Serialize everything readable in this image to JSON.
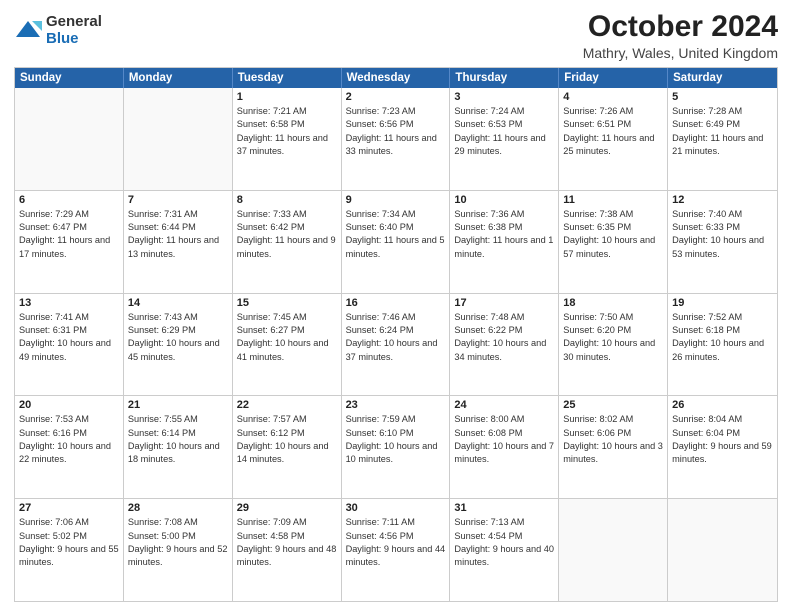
{
  "logo": {
    "general": "General",
    "blue": "Blue"
  },
  "title": "October 2024",
  "location": "Mathry, Wales, United Kingdom",
  "header": {
    "days": [
      "Sunday",
      "Monday",
      "Tuesday",
      "Wednesday",
      "Thursday",
      "Friday",
      "Saturday"
    ]
  },
  "weeks": [
    [
      {
        "day": "",
        "sunrise": "",
        "sunset": "",
        "daylight": ""
      },
      {
        "day": "",
        "sunrise": "",
        "sunset": "",
        "daylight": ""
      },
      {
        "day": "1",
        "sunrise": "Sunrise: 7:21 AM",
        "sunset": "Sunset: 6:58 PM",
        "daylight": "Daylight: 11 hours and 37 minutes."
      },
      {
        "day": "2",
        "sunrise": "Sunrise: 7:23 AM",
        "sunset": "Sunset: 6:56 PM",
        "daylight": "Daylight: 11 hours and 33 minutes."
      },
      {
        "day": "3",
        "sunrise": "Sunrise: 7:24 AM",
        "sunset": "Sunset: 6:53 PM",
        "daylight": "Daylight: 11 hours and 29 minutes."
      },
      {
        "day": "4",
        "sunrise": "Sunrise: 7:26 AM",
        "sunset": "Sunset: 6:51 PM",
        "daylight": "Daylight: 11 hours and 25 minutes."
      },
      {
        "day": "5",
        "sunrise": "Sunrise: 7:28 AM",
        "sunset": "Sunset: 6:49 PM",
        "daylight": "Daylight: 11 hours and 21 minutes."
      }
    ],
    [
      {
        "day": "6",
        "sunrise": "Sunrise: 7:29 AM",
        "sunset": "Sunset: 6:47 PM",
        "daylight": "Daylight: 11 hours and 17 minutes."
      },
      {
        "day": "7",
        "sunrise": "Sunrise: 7:31 AM",
        "sunset": "Sunset: 6:44 PM",
        "daylight": "Daylight: 11 hours and 13 minutes."
      },
      {
        "day": "8",
        "sunrise": "Sunrise: 7:33 AM",
        "sunset": "Sunset: 6:42 PM",
        "daylight": "Daylight: 11 hours and 9 minutes."
      },
      {
        "day": "9",
        "sunrise": "Sunrise: 7:34 AM",
        "sunset": "Sunset: 6:40 PM",
        "daylight": "Daylight: 11 hours and 5 minutes."
      },
      {
        "day": "10",
        "sunrise": "Sunrise: 7:36 AM",
        "sunset": "Sunset: 6:38 PM",
        "daylight": "Daylight: 11 hours and 1 minute."
      },
      {
        "day": "11",
        "sunrise": "Sunrise: 7:38 AM",
        "sunset": "Sunset: 6:35 PM",
        "daylight": "Daylight: 10 hours and 57 minutes."
      },
      {
        "day": "12",
        "sunrise": "Sunrise: 7:40 AM",
        "sunset": "Sunset: 6:33 PM",
        "daylight": "Daylight: 10 hours and 53 minutes."
      }
    ],
    [
      {
        "day": "13",
        "sunrise": "Sunrise: 7:41 AM",
        "sunset": "Sunset: 6:31 PM",
        "daylight": "Daylight: 10 hours and 49 minutes."
      },
      {
        "day": "14",
        "sunrise": "Sunrise: 7:43 AM",
        "sunset": "Sunset: 6:29 PM",
        "daylight": "Daylight: 10 hours and 45 minutes."
      },
      {
        "day": "15",
        "sunrise": "Sunrise: 7:45 AM",
        "sunset": "Sunset: 6:27 PM",
        "daylight": "Daylight: 10 hours and 41 minutes."
      },
      {
        "day": "16",
        "sunrise": "Sunrise: 7:46 AM",
        "sunset": "Sunset: 6:24 PM",
        "daylight": "Daylight: 10 hours and 37 minutes."
      },
      {
        "day": "17",
        "sunrise": "Sunrise: 7:48 AM",
        "sunset": "Sunset: 6:22 PM",
        "daylight": "Daylight: 10 hours and 34 minutes."
      },
      {
        "day": "18",
        "sunrise": "Sunrise: 7:50 AM",
        "sunset": "Sunset: 6:20 PM",
        "daylight": "Daylight: 10 hours and 30 minutes."
      },
      {
        "day": "19",
        "sunrise": "Sunrise: 7:52 AM",
        "sunset": "Sunset: 6:18 PM",
        "daylight": "Daylight: 10 hours and 26 minutes."
      }
    ],
    [
      {
        "day": "20",
        "sunrise": "Sunrise: 7:53 AM",
        "sunset": "Sunset: 6:16 PM",
        "daylight": "Daylight: 10 hours and 22 minutes."
      },
      {
        "day": "21",
        "sunrise": "Sunrise: 7:55 AM",
        "sunset": "Sunset: 6:14 PM",
        "daylight": "Daylight: 10 hours and 18 minutes."
      },
      {
        "day": "22",
        "sunrise": "Sunrise: 7:57 AM",
        "sunset": "Sunset: 6:12 PM",
        "daylight": "Daylight: 10 hours and 14 minutes."
      },
      {
        "day": "23",
        "sunrise": "Sunrise: 7:59 AM",
        "sunset": "Sunset: 6:10 PM",
        "daylight": "Daylight: 10 hours and 10 minutes."
      },
      {
        "day": "24",
        "sunrise": "Sunrise: 8:00 AM",
        "sunset": "Sunset: 6:08 PM",
        "daylight": "Daylight: 10 hours and 7 minutes."
      },
      {
        "day": "25",
        "sunrise": "Sunrise: 8:02 AM",
        "sunset": "Sunset: 6:06 PM",
        "daylight": "Daylight: 10 hours and 3 minutes."
      },
      {
        "day": "26",
        "sunrise": "Sunrise: 8:04 AM",
        "sunset": "Sunset: 6:04 PM",
        "daylight": "Daylight: 9 hours and 59 minutes."
      }
    ],
    [
      {
        "day": "27",
        "sunrise": "Sunrise: 7:06 AM",
        "sunset": "Sunset: 5:02 PM",
        "daylight": "Daylight: 9 hours and 55 minutes."
      },
      {
        "day": "28",
        "sunrise": "Sunrise: 7:08 AM",
        "sunset": "Sunset: 5:00 PM",
        "daylight": "Daylight: 9 hours and 52 minutes."
      },
      {
        "day": "29",
        "sunrise": "Sunrise: 7:09 AM",
        "sunset": "Sunset: 4:58 PM",
        "daylight": "Daylight: 9 hours and 48 minutes."
      },
      {
        "day": "30",
        "sunrise": "Sunrise: 7:11 AM",
        "sunset": "Sunset: 4:56 PM",
        "daylight": "Daylight: 9 hours and 44 minutes."
      },
      {
        "day": "31",
        "sunrise": "Sunrise: 7:13 AM",
        "sunset": "Sunset: 4:54 PM",
        "daylight": "Daylight: 9 hours and 40 minutes."
      },
      {
        "day": "",
        "sunrise": "",
        "sunset": "",
        "daylight": ""
      },
      {
        "day": "",
        "sunrise": "",
        "sunset": "",
        "daylight": ""
      }
    ]
  ]
}
